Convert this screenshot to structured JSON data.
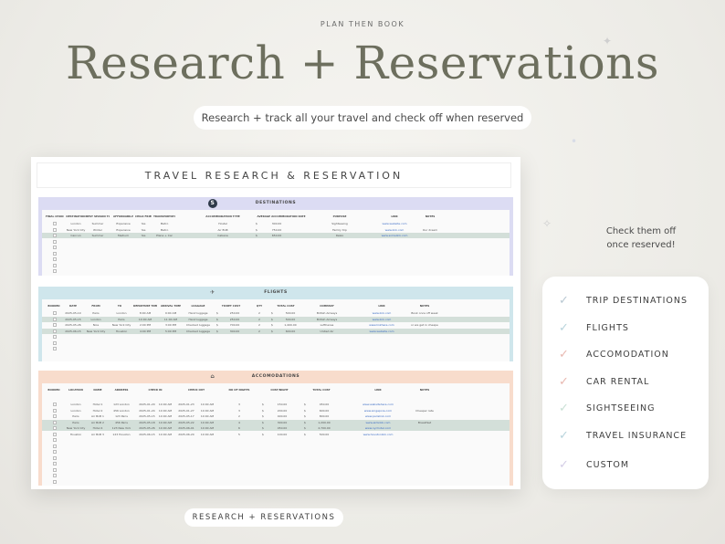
{
  "header": {
    "eyebrow": "PLAN THEN BOOK",
    "title": "Research + Reservations",
    "subtitle": "Research + track all your travel and check off when reserved"
  },
  "sheet": {
    "title": "TRAVEL RESEARCH & RESERVATION",
    "destinations": {
      "label": "DESTINATIONS",
      "color": "#dcdcf3",
      "columns": [
        "FINAL CHOICE",
        "DESTINATION",
        "BEST SEASON TO VISIT",
        "AFFORDABILITY",
        "CHILD FRIENDLY",
        "TRANSPORTATION ACCESS",
        "ACCOMMODATION TYPE",
        "AVERAGE ACCOMMODATION RATE",
        "PURPOSE",
        "LINK",
        "NOTES"
      ],
      "rows": [
        [
          "London",
          "Summer",
          "Expensive",
          "Yes",
          "Metro",
          "Hostel",
          "$",
          "300.00",
          "Sightseeing",
          "www.website.com",
          ""
        ],
        [
          "New York City",
          "Winter",
          "Expensive",
          "Yes",
          "Metro",
          "Air BnB",
          "$",
          "750.00",
          "Family trip",
          "www.link.com",
          "Our dream"
        ],
        [
          "Cancun",
          "Summer",
          "Medium",
          "Yes",
          "Plane + Car",
          "Cabana",
          "$",
          "650.00",
          "Relax",
          "www.somelink.com",
          ""
        ]
      ]
    },
    "flights": {
      "label": "FLIGHTS",
      "color": "#cfe6ec",
      "columns": [
        "BOOKED",
        "DATE",
        "FROM",
        "TO",
        "DEPARTURE TIME",
        "ARRIVAL TIME",
        "LUGGAGE",
        "TICKET COST",
        "QTY",
        "TOTAL COST",
        "COMPANY",
        "LINK",
        "NOTES"
      ],
      "rows": [
        [
          "2025-05-10",
          "Paris",
          "London",
          "8:00 AM",
          "9:00 AM",
          "Hand luggage",
          "$",
          "250.00",
          "2",
          "$",
          "500.00",
          "British Airways",
          "www.link.com",
          "Book once off week"
        ],
        [
          "2025-05-15",
          "London",
          "Paris",
          "10:00 AM",
          "11:00 AM",
          "Hand luggage",
          "$",
          "250.00",
          "2",
          "$",
          "500.00",
          "British Airways",
          "www.link.com",
          ""
        ],
        [
          "2025-05-26",
          "Nice",
          "New York City",
          "2:00 PM",
          "3:00 PM",
          "Checked luggage",
          "$",
          "700.00",
          "2",
          "$",
          "1,400.00",
          "Lufthansa",
          "www.linkhere.com",
          "or we get in cheaper?"
        ],
        [
          "2025-06-15",
          "New York City",
          "Houston",
          "4:00 PM",
          "5:00 PM",
          "Checked luggage",
          "$",
          "300.00",
          "2",
          "$",
          "600.00",
          "United Air",
          "www.website.com",
          ""
        ]
      ]
    },
    "accommodations": {
      "label": "ACCOMODATIONS",
      "color": "#f8dccc",
      "columns": [
        "BOOKED",
        "LOCATION",
        "NAME",
        "ADDRESS",
        "CHECK IN",
        "CHECK OUT",
        "NO OF NIGHTS",
        "COST/NIGHT",
        "TOTAL COST",
        "LINK",
        "NOTES"
      ],
      "rows": [
        [
          "London",
          "Hotel 1",
          "123 London",
          "2025-01-20",
          "10:00 AM",
          "2025-01-23",
          "10:00 AM",
          "3",
          "$",
          "150.00",
          "$",
          "450.00",
          "www.websitehere.com",
          ""
        ],
        [
          "London",
          "Hotel 2",
          "456 London",
          "2025-01-24",
          "10:00 AM",
          "2025-01-27",
          "10:00 AM",
          "3",
          "$",
          "200.00",
          "$",
          "600.00",
          "www.singapore.com",
          "Cheaper rate"
        ],
        [
          "Paris",
          "Air BnB 1",
          "123 Paris",
          "2025-05-15",
          "10:00 AM",
          "2025-05-17",
          "10:00 AM",
          "2",
          "$",
          "400.00",
          "$",
          "800.00",
          "www.parislink.com",
          ""
        ],
        [
          "Paris",
          "Air BnB 2",
          "456 Paris",
          "2025-05-18",
          "10:00 AM",
          "2025-05-22",
          "10:00 AM",
          "4",
          "$",
          "300.00",
          "$",
          "1,200.00",
          "www.airbnbb.com",
          "Breakfast"
        ],
        [
          "New York City",
          "Hotel 4",
          "123 New York",
          "2025-05-26",
          "10:00 AM",
          "2025-06-01",
          "10:00 AM",
          "6",
          "$",
          "450.00",
          "$",
          "2,700.00",
          "www.nychotel.com",
          ""
        ],
        [
          "Houston",
          "Air BnB 3",
          "123 Houston",
          "2025-06-15",
          "10:00 AM",
          "2025-06-20",
          "10:00 AM",
          "5",
          "$",
          "100.00",
          "$",
          "500.00",
          "www.houstonlink.com",
          ""
        ]
      ],
      "subheaders": [
        "DATE",
        "TIME",
        "DATE",
        "TIME"
      ]
    }
  },
  "side_note": {
    "line1": "Check them off",
    "line2": "once reserved!"
  },
  "checklist": {
    "items": [
      "TRIP DESTINATIONS",
      "FLIGHTS",
      "ACCOMODATION",
      "CAR RENTAL",
      "SIGHTSEEING",
      "TRAVEL INSURANCE",
      "CUSTOM"
    ],
    "tick_colors": [
      "#b8c8d2",
      "#b8d4dc",
      "#e8b8b0",
      "#e8b8b0",
      "#c8e0d4",
      "#b8d4dc",
      "#d4cde6"
    ]
  },
  "footer": {
    "label": "RESEARCH + RESERVATIONS"
  }
}
